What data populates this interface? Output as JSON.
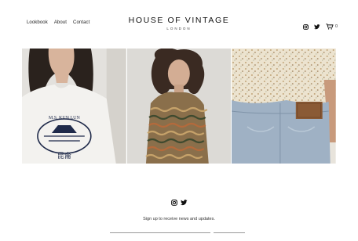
{
  "nav": {
    "items": [
      "Lookbook",
      "About",
      "Contact"
    ]
  },
  "brand": {
    "title": "HOUSE OF VINTAGE",
    "subtitle": "LONDON"
  },
  "header_icons": [
    "instagram-icon",
    "twitter-icon",
    "cart-icon"
  ],
  "cart": {
    "count": "0"
  },
  "gallery": {
    "images": [
      {
        "name": "model-white-tee",
        "shirt_text_top": "M.S. KUN LUN",
        "shirt_text_bottom": "昆侖"
      },
      {
        "name": "model-striped-top"
      },
      {
        "name": "floral-shirt-jeans"
      }
    ]
  },
  "footer": {
    "social_icons": [
      "instagram-icon",
      "twitter-icon"
    ],
    "signup_text": "Sign up to receive news and updates.",
    "email_placeholder": "",
    "submit_label": ""
  },
  "colors": {
    "background": "#ffffff",
    "text": "#1a1a1a"
  }
}
